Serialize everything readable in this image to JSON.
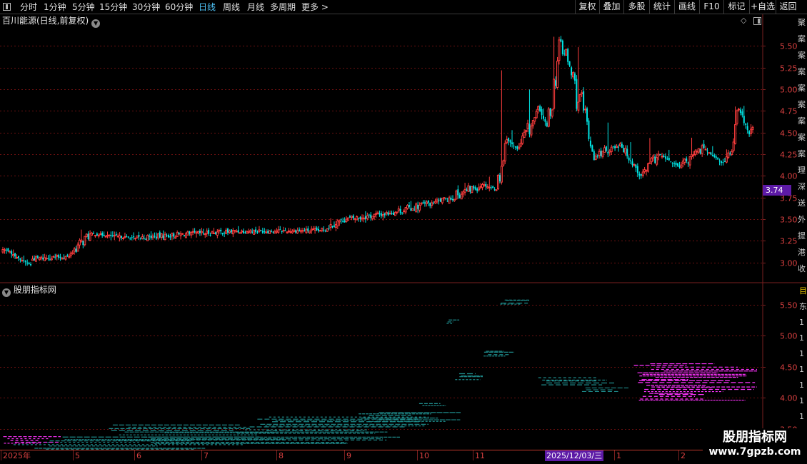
{
  "toolbar": {
    "periods": [
      "分时",
      "1分钟",
      "5分钟",
      "15分钟",
      "30分钟",
      "60分钟",
      "日线",
      "周线",
      "月线",
      "多周期",
      "更多 >"
    ],
    "active_period": "日线",
    "right_buttons": [
      "复权",
      "叠加",
      "多股",
      "统计",
      "画线",
      "F10",
      "标记",
      "+自选",
      "返回"
    ]
  },
  "main_panel": {
    "title": "百川能源(日线,前复权)",
    "current_price_tag": "3.74",
    "right_strip_text": [
      "聚",
      "案",
      "案",
      "案",
      "案",
      "案",
      "案",
      "案",
      "案",
      "理",
      "深",
      "送",
      "外",
      "提",
      "港",
      "收"
    ]
  },
  "sub_panel": {
    "title": "股朋指标网",
    "right_strip_text": [
      "目",
      "东",
      "1",
      "1",
      "1",
      "1",
      "1",
      "1",
      "1",
      "1"
    ]
  },
  "x_axis": {
    "labels": [
      {
        "text": "2025年",
        "pos": 3
      },
      {
        "text": "5",
        "pos": 104
      },
      {
        "text": "6",
        "pos": 190
      },
      {
        "text": "7",
        "pos": 284
      },
      {
        "text": "8",
        "pos": 389
      },
      {
        "text": "9",
        "pos": 484
      },
      {
        "text": "10",
        "pos": 586
      },
      {
        "text": "11",
        "pos": 664
      },
      {
        "text": "1",
        "pos": 862
      },
      {
        "text": "2",
        "pos": 952
      }
    ],
    "cursor_date": "2025/12/03/三"
  },
  "watermark": {
    "title": "股朋指标网",
    "url": "www.7gpzb.com"
  },
  "colors": {
    "up": "#ff3d3d",
    "down": "#00e5e5",
    "grid": "#6b1010",
    "axis_text": "#d94040",
    "chip": "#1e8b8b",
    "chip_recent": "#ff33ff",
    "tag_bg": "#5d1aa6"
  },
  "chart_data": [
    {
      "type": "candlestick",
      "title": "百川能源(日线,前复权)",
      "ylim": [
        2.8,
        5.7
      ],
      "y_ticks": [
        3.0,
        3.25,
        3.5,
        3.75,
        4.0,
        4.25,
        4.5,
        4.75,
        5.0,
        5.25,
        5.5
      ],
      "series": [
        {
          "segments": [
            [
              0,
              3.12,
              3.15,
              3.18,
              3.1
            ],
            [
              3,
              3.15,
              3.13,
              3.17,
              3.1
            ],
            [
              5,
              3.13,
              3.06,
              3.15,
              3.04
            ],
            [
              8,
              3.06,
              2.97,
              3.08,
              2.9
            ],
            [
              22,
              3.04,
              3.07,
              3.1,
              3.02
            ],
            [
              1,
              3.07,
              3.11,
              3.13,
              3.05
            ],
            [
              11,
              3.11,
              3.33,
              3.38,
              3.09
            ],
            [
              26,
              3.33,
              3.28,
              3.36,
              3.18
            ],
            [
              31,
              3.28,
              3.33,
              3.37,
              3.26
            ],
            [
              27,
              3.33,
              3.36,
              3.4,
              3.28
            ],
            [
              48,
              3.36,
              3.37,
              3.42,
              3.33
            ],
            [
              12,
              3.37,
              3.49,
              3.51,
              3.35
            ],
            [
              28,
              3.49,
              3.57,
              3.6,
              3.46
            ],
            [
              24,
              3.57,
              3.69,
              3.72,
              3.55
            ],
            [
              8,
              3.69,
              3.73,
              3.75,
              3.67
            ],
            [
              21,
              3.73,
              3.9,
              3.92,
              3.7
            ],
            [
              8,
              3.9,
              3.84,
              4.0,
              3.8
            ],
            [
              6,
              3.84,
              4.42,
              5.45,
              3.82
            ],
            [
              6,
              4.42,
              4.31,
              4.55,
              4.2
            ],
            [
              13,
              4.31,
              4.75,
              5.05,
              4.25
            ],
            [
              4,
              4.75,
              4.57,
              4.8,
              4.5
            ],
            [
              8,
              4.57,
              5.55,
              5.68,
              4.55
            ],
            [
              20,
              5.55,
              4.23,
              5.6,
              4.18
            ],
            [
              14,
              4.23,
              4.37,
              4.65,
              4.2
            ],
            [
              12,
              4.37,
              4.0,
              4.4,
              3.93
            ],
            [
              10,
              4.0,
              4.25,
              4.5,
              3.98
            ],
            [
              12,
              4.25,
              4.1,
              4.3,
              4.05
            ],
            [
              14,
              4.1,
              4.32,
              4.45,
              4.05
            ],
            [
              10,
              4.32,
              4.15,
              4.35,
              4.05
            ],
            [
              6,
              4.15,
              4.28,
              4.32,
              4.12
            ],
            [
              4,
              4.28,
              4.77,
              4.8,
              4.25
            ],
            [
              6,
              4.77,
              4.48,
              4.82,
              4.3
            ],
            [
              2,
              4.48,
              4.56,
              4.6,
              4.4
            ]
          ]
        }
      ]
    },
    {
      "type": "horizontal-bars",
      "title": "股朋指标网",
      "ylim": [
        3.2,
        5.75
      ],
      "y_ticks": [
        3.5,
        4.0,
        4.5,
        5.0,
        5.5
      ],
      "series": [
        {
          "name": "",
          "bands": [
            {
              "price": 5.53,
              "x_start": 700,
              "x_end": 742,
              "count": 4
            },
            {
              "price": 5.22,
              "x_start": 624,
              "x_end": 645,
              "count": 3
            },
            {
              "price": 4.7,
              "x_start": 668,
              "x_end": 738,
              "count": 4
            },
            {
              "price": 4.33,
              "x_start": 636,
              "x_end": 676,
              "count": 4
            },
            {
              "price": 4.25,
              "x_start": 736,
              "x_end": 860,
              "count": 5
            },
            {
              "price": 4.12,
              "x_start": 812,
              "x_end": 880,
              "count": 3
            },
            {
              "price": 3.88,
              "x_start": 586,
              "x_end": 628,
              "count": 2
            },
            {
              "price": 3.68,
              "x_start": 500,
              "x_end": 645,
              "count": 6
            },
            {
              "price": 3.55,
              "x_start": 330,
              "x_end": 600,
              "count": 10
            },
            {
              "price": 3.4,
              "x_start": 140,
              "x_end": 560,
              "count": 12
            },
            {
              "price": 3.25,
              "x_start": 0,
              "x_end": 400,
              "count": 8
            }
          ]
        },
        {
          "name": "",
          "bands": [
            {
              "price": 4.24,
              "x_start": 886,
              "x_end": 1060,
              "count": 22
            },
            {
              "price": 3.31,
              "x_start": 0,
              "x_end": 85,
              "count": 5
            }
          ]
        }
      ]
    }
  ]
}
